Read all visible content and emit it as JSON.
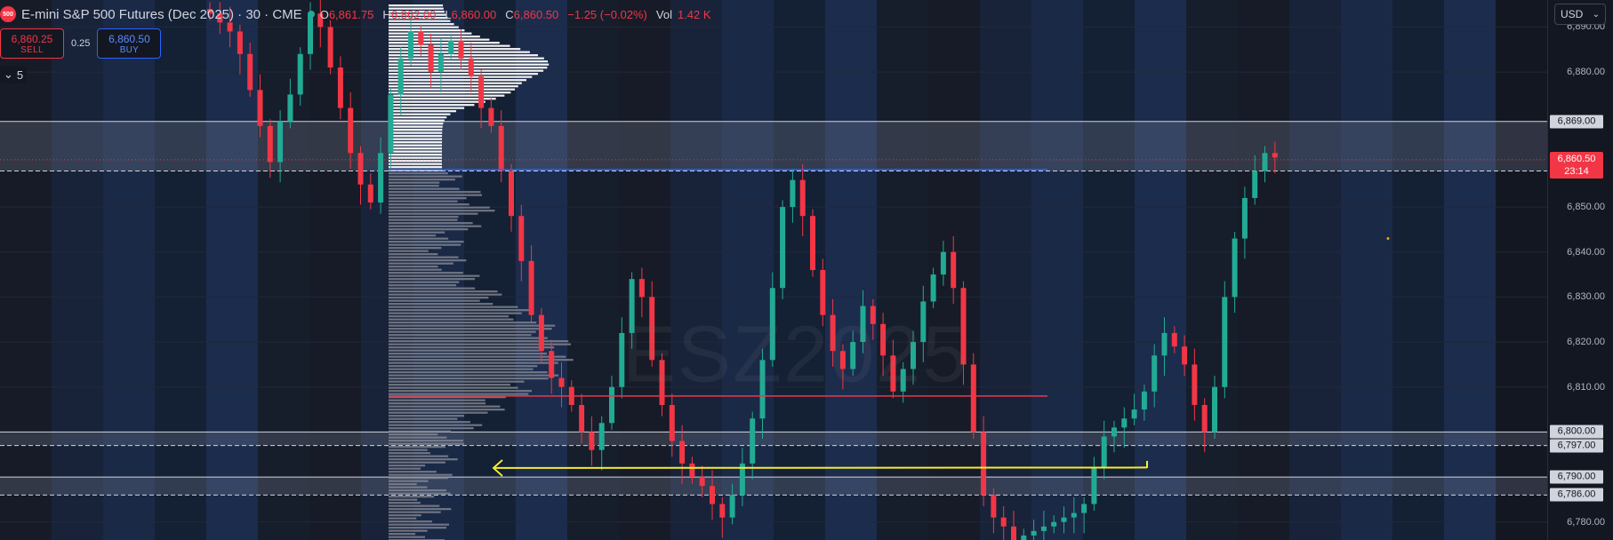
{
  "header": {
    "logo_text": "500",
    "title": "E-mini S&P 500 Futures (Dec 2025) · 30 · CME",
    "ohlc": [
      {
        "k": "O",
        "v": "6,861.75"
      },
      {
        "k": "H",
        "v": "6,862.00"
      },
      {
        "k": "L",
        "v": "6,860.00"
      },
      {
        "k": "C",
        "v": "6,860.50"
      }
    ],
    "change": "−1.25 (−0.02%)",
    "volume_label": "Vol",
    "volume_value": "1.42 K"
  },
  "trade": {
    "sell_price": "6,860.25",
    "sell_label": "SELL",
    "spread": "0.25",
    "buy_price": "6,860.50",
    "buy_label": "BUY"
  },
  "indicators": {
    "toggle_icon": "chevron-down-icon",
    "count": "5"
  },
  "currency": {
    "value": "USD",
    "icon": "chevron-down-icon"
  },
  "watermark": "ESZ2025",
  "colors": {
    "up": "#22ab94",
    "down": "#f23645",
    "background": "#131722",
    "zone": "#9aa0b6",
    "poc_line": "#f23645",
    "arrow": "#f6ec2f",
    "level_line": "#2962ff"
  },
  "price_axis": {
    "ticks": [
      "6,890.00",
      "6,880.00",
      "6,850.00",
      "6,840.00",
      "6,830.00",
      "6,820.00",
      "6,810.00",
      "6,780.00"
    ],
    "levels": [
      "6,869.00",
      "6,858.00",
      "6,800.00",
      "6,797.00",
      "6,790.00",
      "6,786.00"
    ],
    "current_price": "6,860.50",
    "countdown": "23:14"
  },
  "chart_data": {
    "type": "candlestick",
    "ylabel": "",
    "ylim": [
      6776,
      6896
    ],
    "price_ticks": [
      6890,
      6880,
      6850,
      6840,
      6830,
      6820,
      6810,
      6780
    ],
    "zones": [
      {
        "from": 6858,
        "to": 6869
      },
      {
        "from": 6797,
        "to": 6800
      },
      {
        "from": 6786,
        "to": 6790
      }
    ],
    "current_price": 6860.5,
    "poc_price": 6808,
    "arrow_level": 6792,
    "close_series": [
      6893,
      6891,
      6889,
      6884,
      6876,
      6868,
      6860,
      6869,
      6875,
      6884,
      6893,
      6890,
      6881,
      6872,
      6862,
      6855,
      6851,
      6862,
      6875,
      6883,
      6889,
      6886,
      6880,
      6884,
      6887,
      6883,
      6879,
      6872,
      6868,
      6858,
      6848,
      6838,
      6826,
      6818,
      6812,
      6810,
      6806,
      6800,
      6796,
      6802,
      6810,
      6822,
      6834,
      6830,
      6816,
      6806,
      6798,
      6793,
      6790,
      6788,
      6784,
      6781,
      6786,
      6793,
      6803,
      6816,
      6832,
      6850,
      6856,
      6848,
      6836,
      6826,
      6818,
      6814,
      6820,
      6828,
      6824,
      6817,
      6809,
      6814,
      6820,
      6829,
      6835,
      6840,
      6832,
      6815,
      6800,
      6786,
      6781,
      6779,
      6776,
      6777,
      6778,
      6779,
      6780,
      6781,
      6782,
      6784,
      6792,
      6799,
      6801,
      6803,
      6805,
      6809,
      6817,
      6822,
      6819,
      6815,
      6806,
      6800,
      6810,
      6830,
      6843,
      6852,
      6858,
      6862,
      6861
    ]
  }
}
